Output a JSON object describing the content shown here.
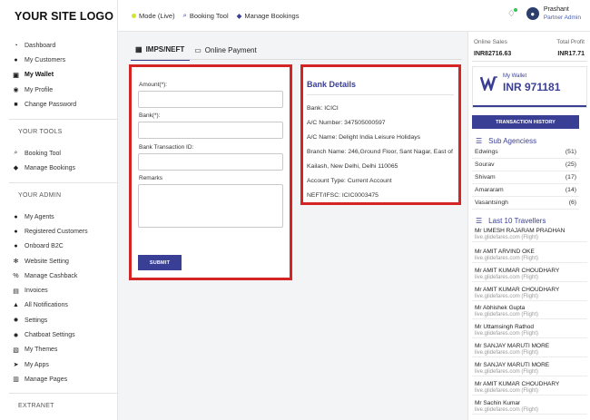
{
  "logo": "YOUR SITE LOGO",
  "sidebar": {
    "main_items": [
      {
        "label": "Dashboard",
        "icon": "dashboard-icon"
      },
      {
        "label": "My Customers",
        "icon": "user-icon"
      },
      {
        "label": "My Wallet",
        "icon": "wallet-icon"
      },
      {
        "label": "My Profile",
        "icon": "user-circle-icon"
      },
      {
        "label": "Change Password",
        "icon": "lock-icon"
      }
    ],
    "tools_title": "YOUR TOOLS",
    "tools_items": [
      {
        "label": "Booking Tool",
        "icon": "search-icon"
      },
      {
        "label": "Manage Bookings",
        "icon": "tag-icon"
      }
    ],
    "admin_title": "YOUR ADMIN",
    "admin_items": [
      {
        "label": "My Agents",
        "icon": "users-icon"
      },
      {
        "label": "Registered Customers",
        "icon": "users-icon"
      },
      {
        "label": "Onboard B2C",
        "icon": "users-icon"
      },
      {
        "label": "Website Setting",
        "icon": "gears-icon"
      },
      {
        "label": "Manage Cashback",
        "icon": "percent-icon"
      },
      {
        "label": "Invoices",
        "icon": "invoice-icon"
      },
      {
        "label": "All Notifications",
        "icon": "bell-icon"
      },
      {
        "label": "Settings",
        "icon": "gear-icon"
      },
      {
        "label": "Chatboat Settings",
        "icon": "gear-icon"
      },
      {
        "label": "My Themes",
        "icon": "theme-icon"
      },
      {
        "label": "My Apps",
        "icon": "paper-plane-icon"
      },
      {
        "label": "Manage Pages",
        "icon": "pages-icon"
      }
    ],
    "extranet_title": "EXTRANET"
  },
  "topbar": {
    "mode": "Mode (Live)",
    "booking_tool": "Booking Tool",
    "manage_bookings": "Manage Bookings",
    "user_name": "Prashant",
    "user_role": "Partner Admin"
  },
  "tabs": {
    "imps": "IMPS/NEFT",
    "online": "Online Payment"
  },
  "form": {
    "amount_label": "Amount(*):",
    "bank_label": "Bank(*):",
    "txn_label": "Bank Transaction ID:",
    "remarks_label": "Remarks",
    "submit": "SUBMIT"
  },
  "bank_details": {
    "title": "Bank Details",
    "bank": "Bank: ICICI",
    "account_number": "A/C Number: 347505000597",
    "account_name": "A/C Name: Delight India Leisure Holidays",
    "branch_1": "Branch Name: 246,Ground Floor, Sant Nagar, East of",
    "branch_2": "Kailash, New Delhi, Delhi 110065",
    "account_type": "Account Type: Current Account",
    "ifsc": "NEFT/IFSC: ICIC0003475"
  },
  "right": {
    "online_sales_label": "Online Sales",
    "total_profit_label": "Total Profit",
    "online_sales_value": "INR82716.63",
    "total_profit_value": "INR17.71",
    "wallet_label": "My Wallet",
    "wallet_amount": "INR 971181",
    "txn_history": "TRANSACTION HISTORY",
    "sub_agencies_title": "Sub Agenciess",
    "agencies": [
      {
        "name": "Edwings",
        "count": "(51)"
      },
      {
        "name": "Sourav",
        "count": "(25)"
      },
      {
        "name": "Shivam",
        "count": "(17)"
      },
      {
        "name": "Amararam",
        "count": "(14)"
      },
      {
        "name": "Vasantsingh",
        "count": "(6)"
      }
    ],
    "travellers_title": "Last 10 Travellers",
    "travellers": [
      {
        "name": "Mr UMESH RAJARAM PRADHAN",
        "sub": "live.glidefares.com (Flight)"
      },
      {
        "name": "Mr AMIT ARVIND OKE",
        "sub": "live.glidefares.com (Flight)"
      },
      {
        "name": "Mr AMIT KUMAR CHOUDHARY",
        "sub": "live.glidefares.com (Flight)"
      },
      {
        "name": "Mr AMIT KUMAR CHOUDHARY",
        "sub": "live.glidefares.com (Flight)"
      },
      {
        "name": "Mr Abhishek Gupta",
        "sub": "live.glidefares.com (Flight)"
      },
      {
        "name": "Mr Uttamsingh Rathod",
        "sub": "live.glidefares.com (Flight)"
      },
      {
        "name": "Mr SANJAY MARUTI MORE",
        "sub": "live.glidefares.com (Flight)"
      },
      {
        "name": "Mr SANJAY MARUTI MORE",
        "sub": "live.glidefares.com (Flight)"
      },
      {
        "name": "Mr AMIT KUMAR CHOUDHARY",
        "sub": "live.glidefares.com (Flight)"
      },
      {
        "name": "Mr Sachin Kumar",
        "sub": "live.glidefares.com (Flight)"
      }
    ]
  }
}
